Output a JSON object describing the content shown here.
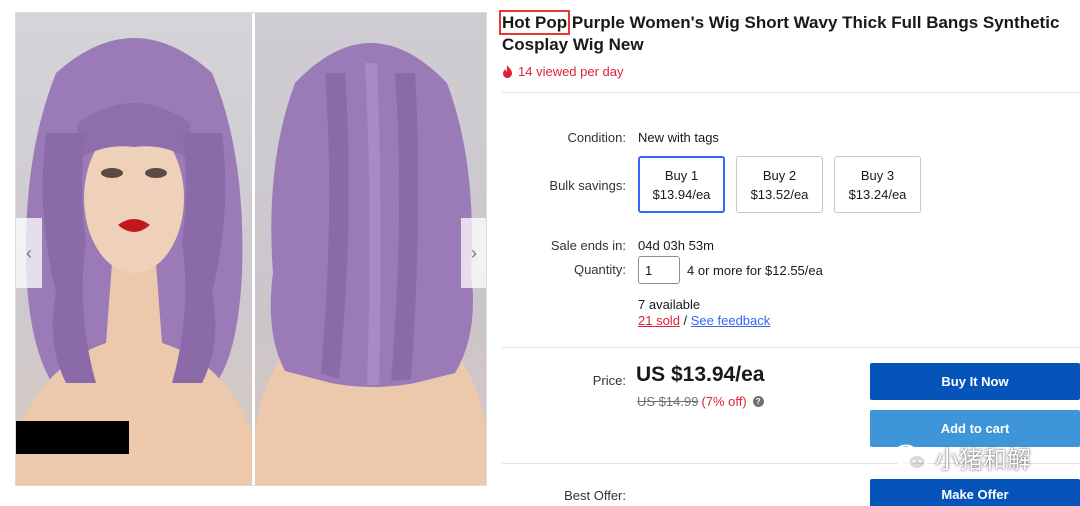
{
  "listing": {
    "brand": "Hot Pop",
    "title_rest": " Purple Women's Wig Short Wavy Thick Full Bangs Synthetic Cosplay Wig New",
    "viewed": "14 viewed per day"
  },
  "gallery": {
    "prev_glyph": "‹",
    "next_glyph": "›"
  },
  "details": {
    "condition_label": "Condition:",
    "condition_value": "New with tags",
    "bulk_label": "Bulk savings:",
    "bulk_options": [
      {
        "qty": "Buy 1",
        "price": "$13.94/ea"
      },
      {
        "qty": "Buy 2",
        "price": "$13.52/ea"
      },
      {
        "qty": "Buy 3",
        "price": "$13.24/ea"
      }
    ],
    "sale_label": "Sale ends in:",
    "sale_value": "04d 03h 53m",
    "quantity_label": "Quantity:",
    "quantity_value": "1",
    "quantity_offer": "4 or more for $12.55/ea",
    "available": "7 available",
    "sold": "21 sold",
    "separator": " / ",
    "feedback": "See feedback"
  },
  "price": {
    "label": "Price:",
    "value": "US $13.94/ea",
    "was": "US $14.99",
    "off": "(7% off)",
    "help_glyph": "?"
  },
  "buttons": {
    "buy_now": "Buy It Now",
    "add_to_cart": "Add to cart",
    "make_offer": "Make Offer"
  },
  "best_offer": {
    "label": "Best Offer:"
  },
  "watermark": {
    "text": "小猪和解"
  },
  "colors": {
    "accent_blue": "#3665f3",
    "buy_now_blue": "#0654ba",
    "cart_blue": "#3e95d8",
    "alert_red": "#e0203a",
    "highlight_box": "#e53935",
    "wig_purple": "#9a7bb8"
  },
  "icons": [
    "fire-icon",
    "chevron-left-icon",
    "chevron-right-icon",
    "help-icon",
    "wechat-icon"
  ]
}
